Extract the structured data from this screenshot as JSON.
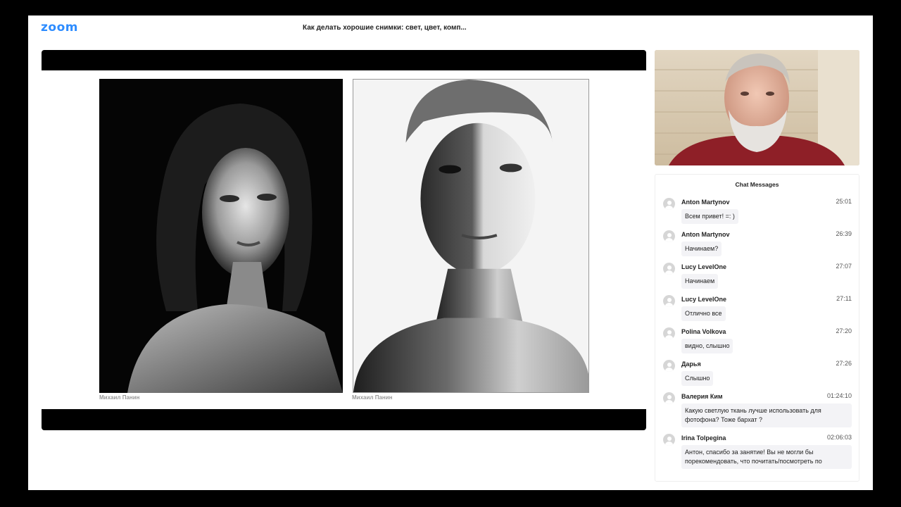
{
  "app": {
    "logo": "zoom",
    "meeting_title": "Как делать хорошие снимки: свет, цвет, комп...",
    "brand_color": "#2D8CFF"
  },
  "share": {
    "captions": [
      "Михаил Панин",
      "Михаил Панин"
    ]
  },
  "chat": {
    "header": "Chat Messages",
    "messages": [
      {
        "sender": "Anton Martynov",
        "time": "25:01",
        "text": "Всем привет! =: )"
      },
      {
        "sender": "Anton Martynov",
        "time": "26:39",
        "text": "Начинаем?"
      },
      {
        "sender": "Lucy LevelOne",
        "time": "27:07",
        "text": "Начинаем"
      },
      {
        "sender": "Lucy LevelOne",
        "time": "27:11",
        "text": "Отлично все"
      },
      {
        "sender": "Polina Volkova",
        "time": "27:20",
        "text": "видно, слышно"
      },
      {
        "sender": "Дарья",
        "time": "27:26",
        "text": "Слышно"
      },
      {
        "sender": "Валерия Ким",
        "time": "01:24:10",
        "text": "Какую светлую ткань лучше использовать для фотофона? Тоже бархат ?"
      },
      {
        "sender": "Irina Tolpegina",
        "time": "02:06:03",
        "text": "Антон, спасибо за занятие! Вы не могли бы порекомендовать, что почитать/посмотреть по"
      }
    ]
  }
}
